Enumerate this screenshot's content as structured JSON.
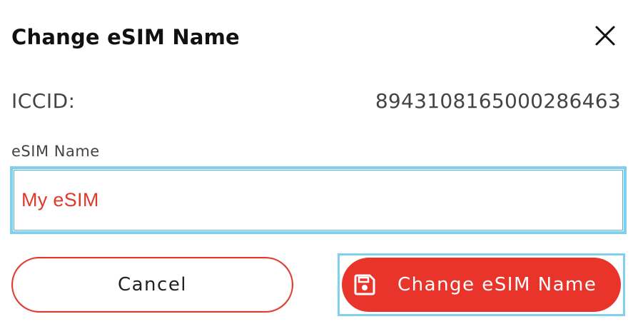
{
  "dialog": {
    "title": "Change eSIM Name",
    "close_icon": "close-icon"
  },
  "iccid": {
    "label": "ICCID:",
    "value": "8943108165000286463"
  },
  "esim_name": {
    "label": "eSIM Name",
    "value": "My eSIM"
  },
  "actions": {
    "cancel_label": "Cancel",
    "submit_label": "Change eSIM Name",
    "submit_icon": "save-icon"
  },
  "colors": {
    "accent": "#e8342a",
    "focus_ring": "#7fd0ee",
    "text": "#222222"
  }
}
